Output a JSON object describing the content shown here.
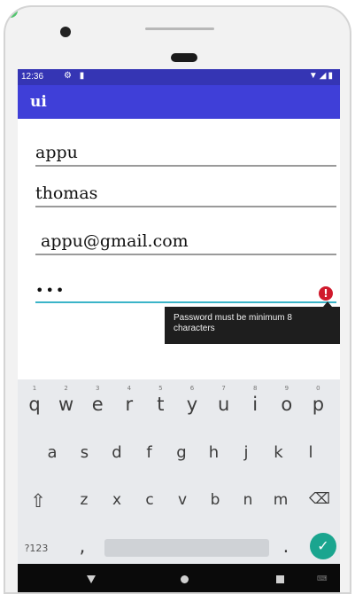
{
  "status_bar": {
    "time": "12:36",
    "left_icons": "⚙ ▮",
    "right_icons": "▼◢▮"
  },
  "app_bar": {
    "title": "ui"
  },
  "form": {
    "first_name": "appu",
    "last_name": "thomas",
    "email": "appu@gmail.com",
    "password_masked": "•••",
    "error_message": "Password must be minimum 8 characters"
  },
  "keyboard": {
    "row1": [
      {
        "key": "q",
        "hint": "1"
      },
      {
        "key": "w",
        "hint": "2"
      },
      {
        "key": "e",
        "hint": "3"
      },
      {
        "key": "r",
        "hint": "4"
      },
      {
        "key": "t",
        "hint": "5"
      },
      {
        "key": "y",
        "hint": "6"
      },
      {
        "key": "u",
        "hint": "7"
      },
      {
        "key": "i",
        "hint": "8"
      },
      {
        "key": "o",
        "hint": "9"
      },
      {
        "key": "p",
        "hint": "0"
      }
    ],
    "row2": [
      "a",
      "s",
      "d",
      "f",
      "g",
      "h",
      "j",
      "k",
      "l"
    ],
    "row3": [
      "z",
      "x",
      "c",
      "v",
      "b",
      "n",
      "m"
    ],
    "shift_icon": "⇧",
    "backspace_icon": "⌫",
    "symbols_key": "?123",
    "comma_key": ",",
    "period_key": ".",
    "enter_icon": "✓"
  },
  "nav_bar": {
    "ime_label": "⌨"
  },
  "colors": {
    "status_bar": "#3535b4",
    "app_bar": "#3f3fd8",
    "focused_underline": "#3bb4c8",
    "error": "#d0192c",
    "enter_key": "#1aa58f"
  }
}
